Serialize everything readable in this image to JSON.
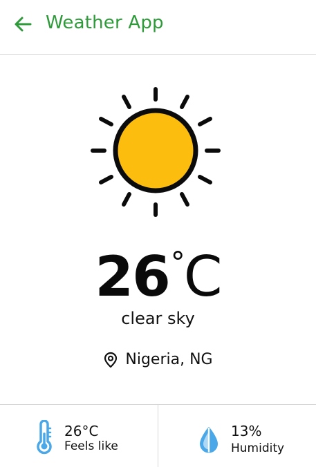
{
  "header": {
    "title": "Weather App",
    "accent_color": "#2e9a3a",
    "back_icon": "arrow-left-icon"
  },
  "weather": {
    "icon": "sun-icon",
    "temperature_value": "26",
    "temperature_degree": "°",
    "temperature_unit": "C",
    "description": "clear sky",
    "location_icon": "location-pin-icon",
    "location": "Nigeria, NG",
    "sun_color": "#fcbd0f"
  },
  "stats": {
    "feels_like": {
      "icon": "thermometer-icon",
      "value": "26°C",
      "label": "Feels like"
    },
    "humidity": {
      "icon": "water-drop-icon",
      "value": "13%",
      "label": "Humidity"
    },
    "icon_color": "#4aa8e8"
  }
}
